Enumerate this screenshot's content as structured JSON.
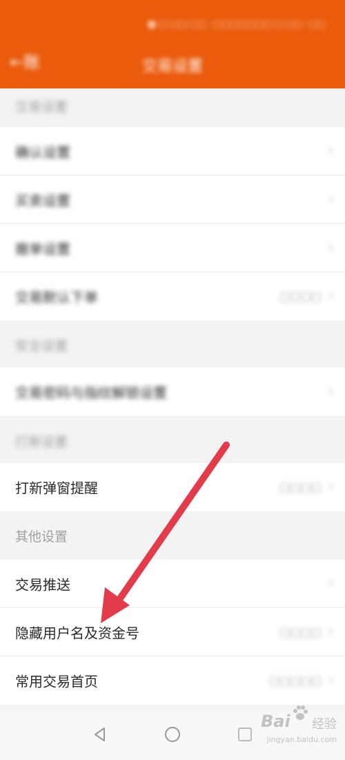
{
  "header": {
    "status_text": "■·□·□□·□□  ·□□□□□□□·□·□□ ·□□",
    "back_label": "←账",
    "title": "交易设置"
  },
  "sections": {
    "s1_label": "交易设置",
    "s1_rows": [
      {
        "label": "确认设置",
        "value": ""
      },
      {
        "label": "买卖设置",
        "value": ""
      },
      {
        "label": "撤单设置",
        "value": ""
      },
      {
        "label": "交易默认下单",
        "value": "□□□□"
      }
    ],
    "s2_label": "安全设置",
    "s2_rows": [
      {
        "label": "交易密码与指纹解锁设置",
        "value": ""
      }
    ],
    "s3_label": "打新设置",
    "s3_rows": [
      {
        "label": "打新弹窗提醒",
        "value": "□□□□"
      }
    ],
    "s4_label": "其他设置",
    "s4_rows": [
      {
        "label": "交易推送",
        "value": ""
      },
      {
        "label": "隐藏用户名及资金号",
        "value": "□□□□"
      },
      {
        "label": "常用交易首页",
        "value": "□□□□□"
      }
    ]
  },
  "watermark": {
    "brand": "Bai",
    "sub": "经验",
    "url": "jingyan.baidu.com"
  },
  "colors": {
    "header": "#ea5b0c",
    "arrow": "#e23c4a",
    "background": "#f3f3f3"
  },
  "icons": [
    "back-icon",
    "chevron-right-icon",
    "nav-back-icon",
    "nav-home-icon",
    "nav-recents-icon",
    "baidu-paw-icon",
    "annotation-arrow"
  ]
}
